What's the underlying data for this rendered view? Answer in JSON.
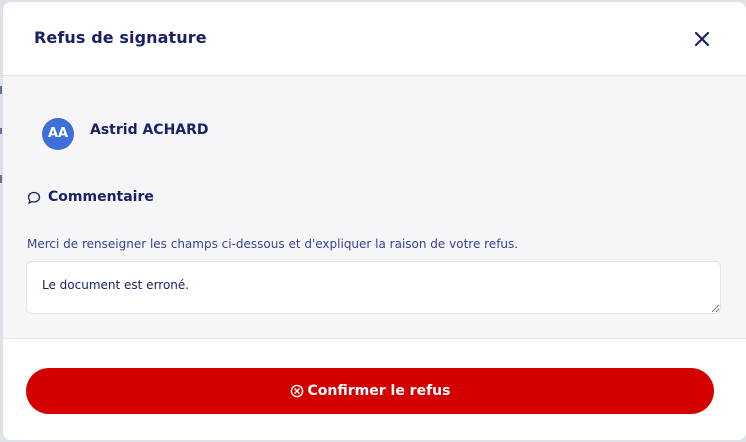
{
  "modal": {
    "title": "Refus de signature",
    "close_icon": "close-icon"
  },
  "signer": {
    "initials": "AA",
    "name": "Astrid ACHARD",
    "avatar_color": "#3e6ed8"
  },
  "comment": {
    "icon": "comment-icon",
    "heading": "Commentaire",
    "instructions": "Merci de renseigner les champs ci-dessous et d'expliquer la raison de votre refus.",
    "value": "Le document est erroné."
  },
  "footer": {
    "confirm_icon": "circle-x-icon",
    "confirm_label": "Confirmer le refus",
    "confirm_color": "#d40000"
  },
  "colors": {
    "title_text": "#1b2166",
    "body_background": "#f6f6f8"
  }
}
